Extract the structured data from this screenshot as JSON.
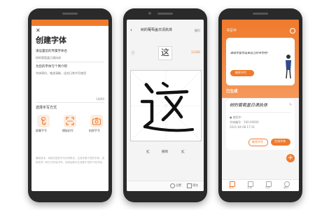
{
  "phone1": {
    "close_icon": "close-icon",
    "title": "创建字体",
    "name_label": "请设置您的专属字体名",
    "name_value": "树的葡萄盖日清执体",
    "intro_label": "为您的字体写个简介吧",
    "intro_text": "字体简约，笔迹清晰，适合日常书写使用",
    "counter": "18/60",
    "method_label": "选择手写方式",
    "methods": [
      "屏幕手写",
      "模板拍写",
      "拍照手写"
    ],
    "footer": "最新技术，采用先进的手写识别算法，生成专属于您的字体。选择任意一种方式开始书写，完成后即可生成属于您的个性字体。",
    "accent": "#f07a2c"
  },
  "phone2": {
    "title": "树的葡萄盖日清执体",
    "top_right": "指引",
    "target_char": "这",
    "progress": "1/100",
    "prev_label": "K",
    "undo_label": "撤销",
    "next_label": "K",
    "bottom_left": "设置",
    "bottom_right": "预览"
  },
  "phone3": {
    "header_title": "书写中",
    "card_text": "继续写我写出来自己的书写吧！",
    "card_button": "继续书写",
    "section_title": "已生成",
    "font_name": "树的葡萄盖日清执体",
    "info_lines": [
      "● 使用中",
      "字体编号：100.00000",
      "2021-04-08 17:31"
    ],
    "btn_secondary": "继续书写",
    "btn_primary": "生成字体",
    "nav": [
      "首页",
      "字体",
      "任务",
      "我的"
    ],
    "accent": "#f07a2c"
  }
}
